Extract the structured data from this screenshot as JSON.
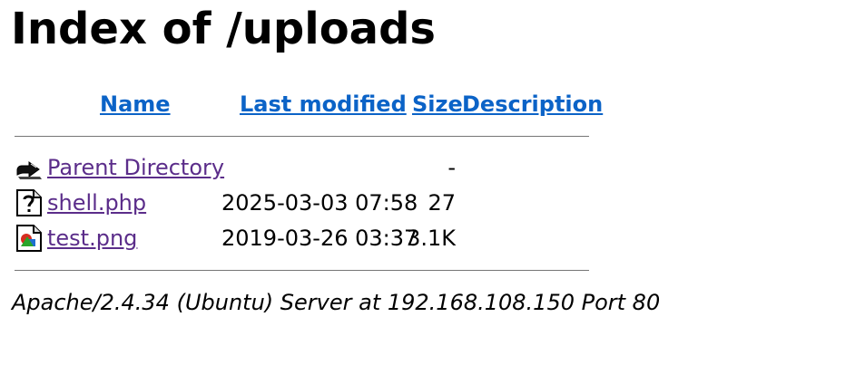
{
  "page": {
    "title": "Index of /uploads"
  },
  "table": {
    "headers": {
      "name": "Name",
      "last_modified": "Last modified",
      "size": "Size",
      "description": "Description"
    },
    "rows": [
      {
        "icon": "parent-directory-icon",
        "name": "Parent Directory",
        "last_modified": "",
        "size": "-",
        "description": ""
      },
      {
        "icon": "unknown-file-icon",
        "name": "shell.php",
        "last_modified": "2025-03-03 07:58",
        "size": "27",
        "description": ""
      },
      {
        "icon": "image-file-icon",
        "name": "test.png",
        "last_modified": "2019-03-26 03:37",
        "size": "3.1K",
        "description": ""
      }
    ]
  },
  "footer": {
    "address": "Apache/2.4.34 (Ubuntu) Server at 192.168.108.150 Port 80"
  },
  "colors": {
    "header_link": "#0b63c7",
    "visited_link": "#5b2d8a",
    "rule": "#767676",
    "text": "#000000"
  }
}
